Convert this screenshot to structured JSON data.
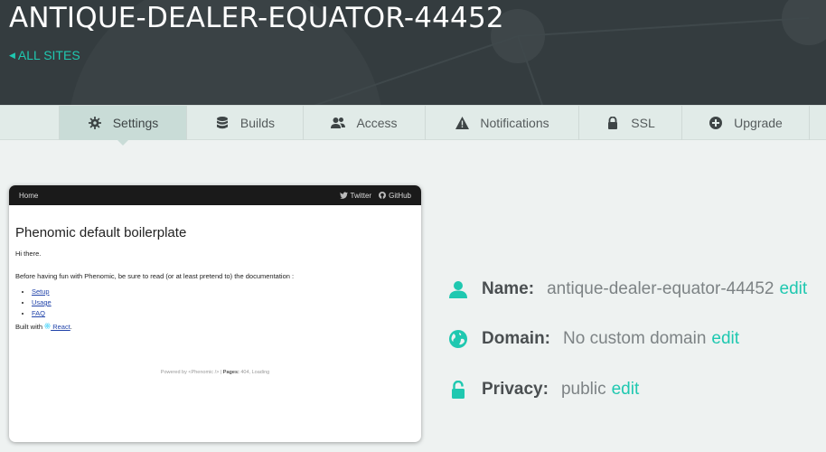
{
  "header": {
    "site_name": "ANTIQUE-DEALER-EQUATOR-44452",
    "back_link": "ALL SITES"
  },
  "colors": {
    "accent": "#1fc8b0",
    "header_bg": "#343c3f",
    "tab_bg": "#e1ebe8",
    "tab_active_bg": "#c9dcd7"
  },
  "tabs": [
    {
      "label": "Settings",
      "icon": "gear-icon",
      "active": true
    },
    {
      "label": "Builds",
      "icon": "database-icon"
    },
    {
      "label": "Access",
      "icon": "users-icon"
    },
    {
      "label": "Notifications",
      "icon": "warning-icon"
    },
    {
      "label": "SSL",
      "icon": "lock-icon"
    },
    {
      "label": "Upgrade",
      "icon": "plus-circle-icon"
    }
  ],
  "preview": {
    "nav_home": "Home",
    "nav_twitter": "Twitter",
    "nav_github": "GitHub",
    "title": "Phenomic default boilerplate",
    "greeting": "Hi there.",
    "intro": "Before having fun with Phenomic, be sure to read (or at least pretend to) the documentation :",
    "links": [
      "Setup",
      "Usage",
      "FAQ"
    ],
    "built_with_prefix": "Built with",
    "built_with_link": " React",
    "built_with_suffix": ".",
    "footer_prefix": "Powered by <Phenomic /> |",
    "footer_pages": "Pages:",
    "footer_pages_value": "404",
    "footer_loading": ", Loading"
  },
  "info": {
    "name": {
      "label": "Name:",
      "value": "antique-dealer-equator-44452",
      "edit": "edit",
      "icon": "user-icon"
    },
    "domain": {
      "label": "Domain:",
      "value": "No custom domain",
      "edit": "edit",
      "icon": "globe-icon"
    },
    "privacy": {
      "label": "Privacy:",
      "value": "public",
      "edit": "edit",
      "icon": "unlock-icon"
    }
  }
}
